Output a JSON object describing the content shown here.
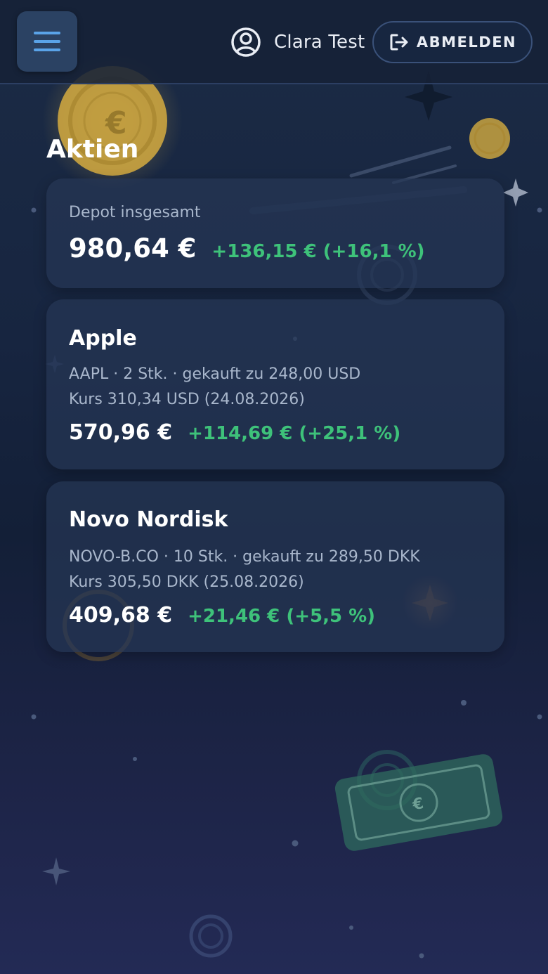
{
  "header": {
    "user_name": "Clara Test",
    "logout_label": "ABMELDEN"
  },
  "page": {
    "title": "Aktien"
  },
  "total": {
    "label": "Depot insgesamt",
    "value": "980,64 €",
    "change": "+136,15 € (+16,1 %)"
  },
  "positions": [
    {
      "name": "Apple",
      "details": "AAPL · 2 Stk. · gekauft zu 248,00 USD",
      "quote": "Kurs 310,34 USD (24.08.2026)",
      "value": "570,96 €",
      "change": "+114,69 € (+25,1 %)"
    },
    {
      "name": "Novo Nordisk",
      "details": "NOVO-B.CO · 10 Stk. · gekauft zu 289,50 DKK",
      "quote": "Kurs 305,50 DKK (25.08.2026)",
      "value": "409,68 €",
      "change": "+21,46 € (+5,5 %)"
    }
  ],
  "colors": {
    "accent": "#5aa3e8",
    "gain": "#3ec27a",
    "card": "#263655",
    "coin": "#c9a340",
    "banknote": "#2f6b5e"
  },
  "icons": {
    "menu": "hamburger-icon",
    "user": "user-circle-icon",
    "logout": "logout-icon"
  },
  "banknote_symbol": "€",
  "coin_symbol": "€"
}
